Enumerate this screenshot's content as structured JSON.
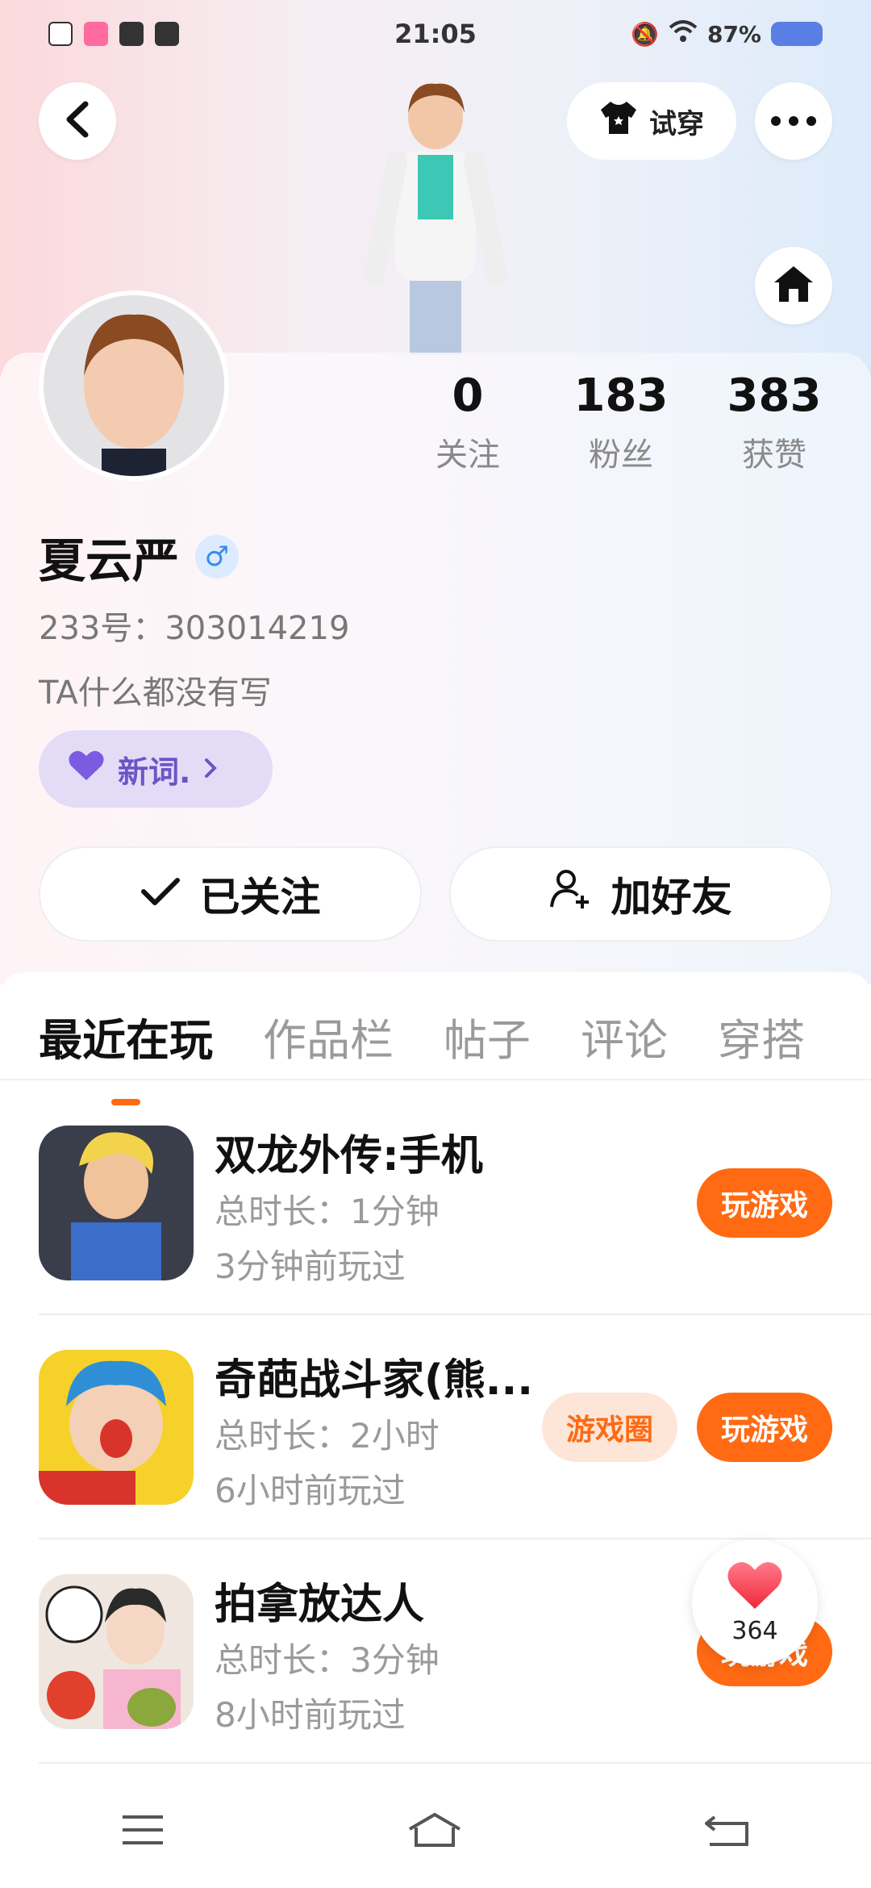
{
  "status_bar": {
    "time": "21:05",
    "battery": "87%"
  },
  "header": {
    "try_on_label": "试穿"
  },
  "profile": {
    "stats": [
      {
        "value": "0",
        "label": "关注"
      },
      {
        "value": "183",
        "label": "粉丝"
      },
      {
        "value": "383",
        "label": "获赞"
      }
    ],
    "name": "夏云严",
    "gender_symbol": "♂",
    "id_line": "233号：303014219",
    "bio": "TA什么都没有写",
    "tag_label": "新词."
  },
  "actions": {
    "follow_label": "已关注",
    "add_friend_label": "加好友"
  },
  "tabs": [
    "最近在玩",
    "作品栏",
    "帖子",
    "评论",
    "穿搭"
  ],
  "games": [
    {
      "title": "双龙外传:手机",
      "duration": "总时长：1分钟",
      "last_played": "3分钟前玩过",
      "play_label": "玩游戏"
    },
    {
      "title": "奇葩战斗家(熊...",
      "duration": "总时长：2小时",
      "last_played": "6小时前玩过",
      "play_label": "玩游戏",
      "circle_label": "游戏圈"
    },
    {
      "title": "拍拿放达人",
      "duration": "总时长：3分钟",
      "last_played": "8小时前玩过",
      "play_label": "玩游戏"
    }
  ],
  "like_float": {
    "count": "364"
  },
  "colors": {
    "accent": "#ff6a13",
    "tag_bg": "#e4dcf6",
    "tag_text": "#6a55c7"
  },
  "icons": {
    "back": "chevron-left-icon",
    "shirt": "shirt-icon",
    "more": "more-dots-icon",
    "home": "home-icon",
    "heart": "heart-icon",
    "check": "check-icon",
    "add_user": "add-user-icon"
  }
}
